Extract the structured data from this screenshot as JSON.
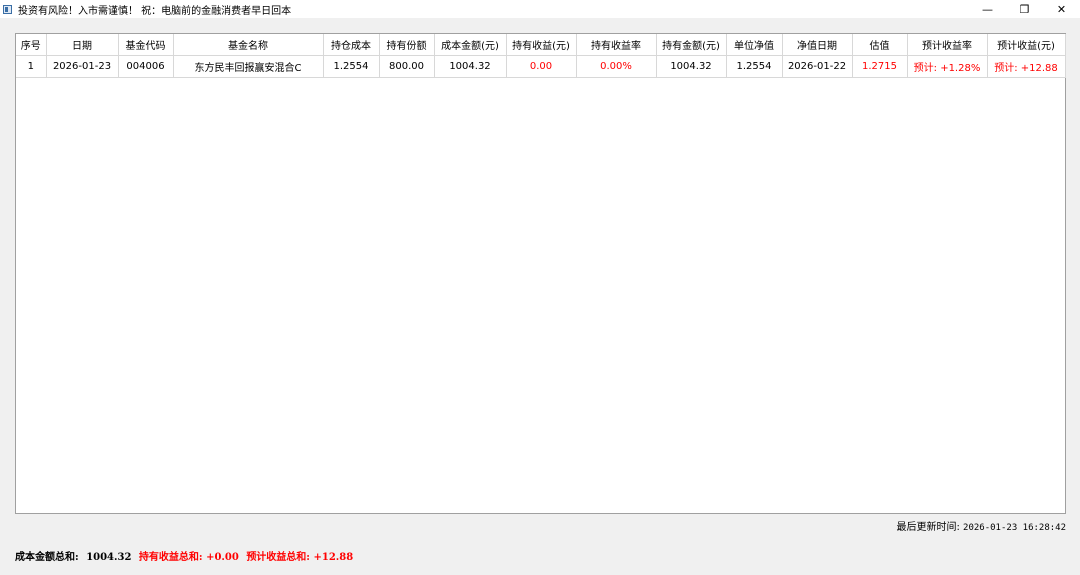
{
  "window": {
    "title": "投资有风险！入市需谨慎！ 祝：电脑前的金融消费者早日回本",
    "minimize": "—",
    "maximize": "❐",
    "close": "✕"
  },
  "table": {
    "headers": [
      "序号",
      "日期",
      "基金代码",
      "基金名称",
      "持仓成本",
      "持有份额",
      "成本金额(元)",
      "持有收益(元)",
      "持有收益率",
      "持有金额(元)",
      "单位净值",
      "净值日期",
      "估值",
      "预计收益率",
      "预计收益(元)"
    ],
    "rows": [
      [
        "1",
        "2026-01-23",
        "004006",
        "东方民丰回报赢安混合C",
        "1.2554",
        "800.00",
        "1004.32",
        "0.00",
        "0.00%",
        "1004.32",
        "1.2554",
        "2026-01-22",
        "1.2715",
        "预计: +1.28%",
        "预计: +12.88"
      ]
    ]
  },
  "status": {
    "last_update_label": "最后更新时间:",
    "last_update_value": "2026-01-23 16:28:42"
  },
  "summary": {
    "cost_label": "成本金额总和:",
    "cost_value": "1004.32",
    "hold_profit": "持有收益总和: +0.00",
    "est_profit": "预计收益总和: +12.88"
  },
  "colors": {
    "profit": "#ff0000"
  }
}
